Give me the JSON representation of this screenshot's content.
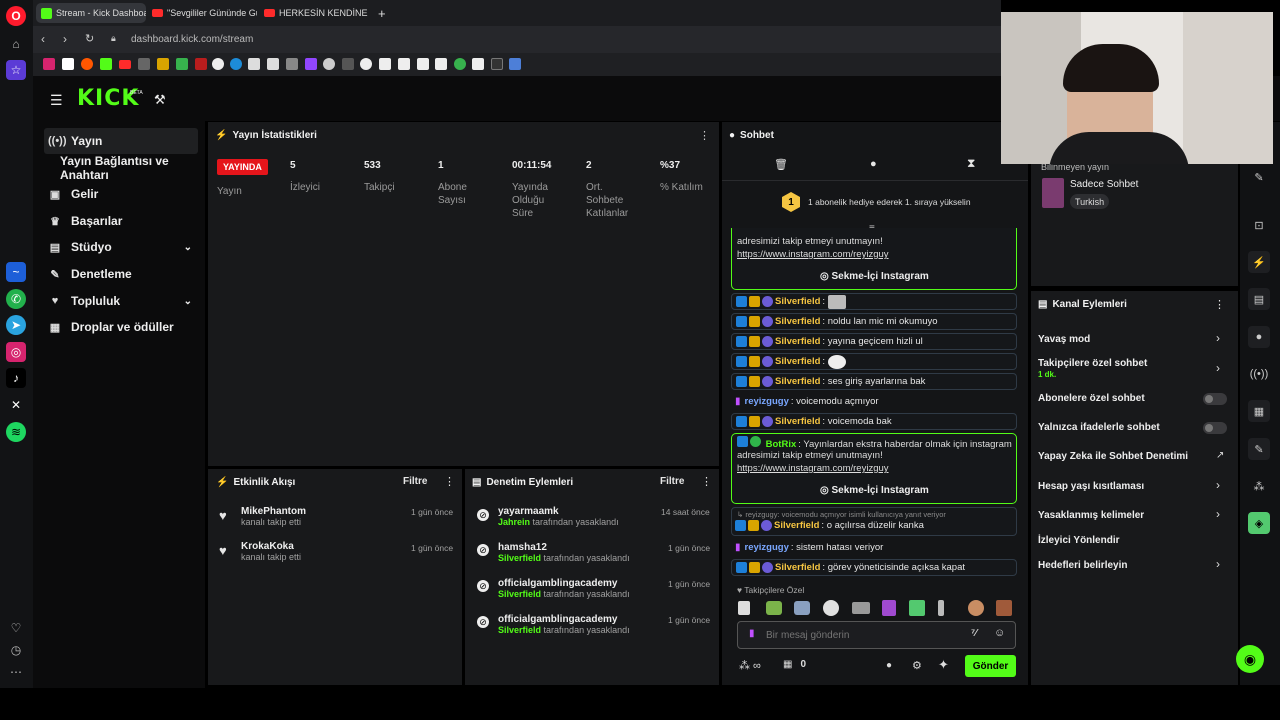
{
  "browser": {
    "tabs": [
      {
        "label": "Stream - Kick Dashboard",
        "color": "#53fc18"
      },
      {
        "label": "\"Sevgililer Gününde Güld",
        "color": "#ff2b2b"
      },
      {
        "label": "HERKESİN KENDİNE YAKIŞ",
        "color": "#ff2b2b"
      }
    ],
    "address": "dashboard.kick.com/stream"
  },
  "kick": {
    "logo": "KICK",
    "beta": "BETA"
  },
  "nav": {
    "items": [
      {
        "label": "Yayın",
        "icon": "broadcast-icon"
      },
      {
        "label": "Yayın Bağlantısı ve Anahtarı",
        "icon": ""
      },
      {
        "label": "Gelir",
        "icon": "dollar-icon"
      },
      {
        "label": "Başarılar",
        "icon": "trophy-icon"
      },
      {
        "label": "Stüdyo",
        "icon": "studio-icon"
      },
      {
        "label": "Denetleme",
        "icon": "wrench-icon"
      },
      {
        "label": "Topluluk",
        "icon": "community-icon"
      },
      {
        "label": "Droplar ve ödüller",
        "icon": "gift-icon"
      }
    ]
  },
  "stats": {
    "title": "Yayın İstatistikleri",
    "live_badge": "YAYINDA",
    "live_label": "Yayın",
    "items": [
      {
        "value": "5",
        "label": "İzleyici"
      },
      {
        "value": "533",
        "label": "Takipçi"
      },
      {
        "value": "1",
        "label": "Abone Sayısı"
      },
      {
        "value": "00:11:54",
        "label": "Yayında Olduğu Süre"
      },
      {
        "value": "2",
        "label": "Ort. Sohbete Katılanlar"
      },
      {
        "value": "%37",
        "label": "% Katılım"
      }
    ]
  },
  "activity": {
    "title": "Etkinlik Akışı",
    "filter": "Filtre",
    "items": [
      {
        "name": "MikePhantom",
        "sub": "kanalı takip etti",
        "time": "1 gün önce"
      },
      {
        "name": "KrokaKoka",
        "sub": "kanalı takip etti",
        "time": "1 gün önce"
      }
    ]
  },
  "moderation": {
    "title": "Denetim Eylemleri",
    "filter": "Filtre",
    "items": [
      {
        "name": "yayarmaamk",
        "by": "Jahrein",
        "rest": "tarafından yasaklandı",
        "time": "14 saat önce"
      },
      {
        "name": "hamsha12",
        "by": "Silverfield",
        "rest": "tarafından yasaklandı",
        "time": "1 gün önce"
      },
      {
        "name": "officialgamblingacademy",
        "by": "Silverfield",
        "rest": "tarafından yasaklandı",
        "time": "1 gün önce"
      },
      {
        "name": "officialgamblingacademy",
        "by": "Silverfield",
        "rest": "tarafından yasaklandı",
        "time": "1 gün önce"
      }
    ]
  },
  "chat": {
    "title": "Sohbet",
    "gift_text": "1 abonelik hediye ederek 1. sıraya yükselin",
    "gift_rank": "1",
    "bot_top_line1": "adresimizi takip etmeyi unutmayın!",
    "bot_top_link": "https://www.instagram.com/reyizguy",
    "insta_button": "Sekme-İçi Instagram",
    "messages": [
      {
        "user": "Silverfield",
        "text": "",
        "type": "mod"
      },
      {
        "user": "Silverfield",
        "text": "noldu lan mic mi okumuyo",
        "type": "mod"
      },
      {
        "user": "Silverfield",
        "text": "yayına geçicem hizli ul",
        "type": "mod"
      },
      {
        "user": "Silverfield",
        "text": "",
        "type": "mod"
      },
      {
        "user": "Silverfield",
        "text": "ses giriş ayarlarına bak",
        "type": "mod"
      },
      {
        "user": "reyizgugy",
        "text": "voicemodu açmıyor",
        "type": "host"
      },
      {
        "user": "Silverfield",
        "text": "voicemoda bak",
        "type": "mod"
      }
    ],
    "bot": {
      "user": "BotRix",
      "line1": "Yayınlardan ekstra haberdar olmak için instagram",
      "line2": "adresimizi takip etmeyi unutmayın!",
      "link": "https://www.instagram.com/reyizguy",
      "button": "Sekme-İçi Instagram"
    },
    "reply_ref": "reyizgugy: voicemodu açmıyor isimli kullanıcıya yanıt veriyor",
    "after": [
      {
        "user": "Silverfield",
        "text": "o açılırsa düzelir kanka",
        "type": "mod"
      },
      {
        "user": "reyizgugy",
        "text": "sistem hatası veriyor",
        "type": "host"
      },
      {
        "user": "Silverfield",
        "text": "görev yöneticisinde açıksa kapat",
        "type": "mod"
      }
    ],
    "emote_header": "Takipçilere Özel",
    "input_placeholder": "Bir mesaj gönderin",
    "infinity": "∞",
    "count": "0",
    "send": "Gönder"
  },
  "stream_info": {
    "category_label": "Bilinmeyen yayın",
    "mode": "Sadece Sohbet",
    "language": "Turkish"
  },
  "channel_actions": {
    "title": "Kanal Eylemleri",
    "items": [
      {
        "label": "Yavaş mod",
        "control": "chevron"
      },
      {
        "label": "Takipçilere özel sohbet",
        "sub": "1 dk.",
        "control": "chevron"
      },
      {
        "label": "Abonelere özel sohbet",
        "control": "toggle"
      },
      {
        "label": "Yalnızca ifadelerle sohbet",
        "control": "toggle"
      },
      {
        "label": "Yapay Zeka ile Sohbet Denetimi",
        "control": "external"
      },
      {
        "label": "Hesap yaşı kısıtlaması",
        "control": "chevron"
      },
      {
        "label": "Yasaklanmış kelimeler",
        "control": "chevron"
      },
      {
        "label": "İzleyici Yönlendir",
        "control": "none"
      },
      {
        "label": "Hedefleri belirleyin",
        "control": "chevron"
      }
    ]
  },
  "colors": {
    "accent": "#53fc18",
    "live": "#e5151b",
    "panel": "#18191b"
  }
}
